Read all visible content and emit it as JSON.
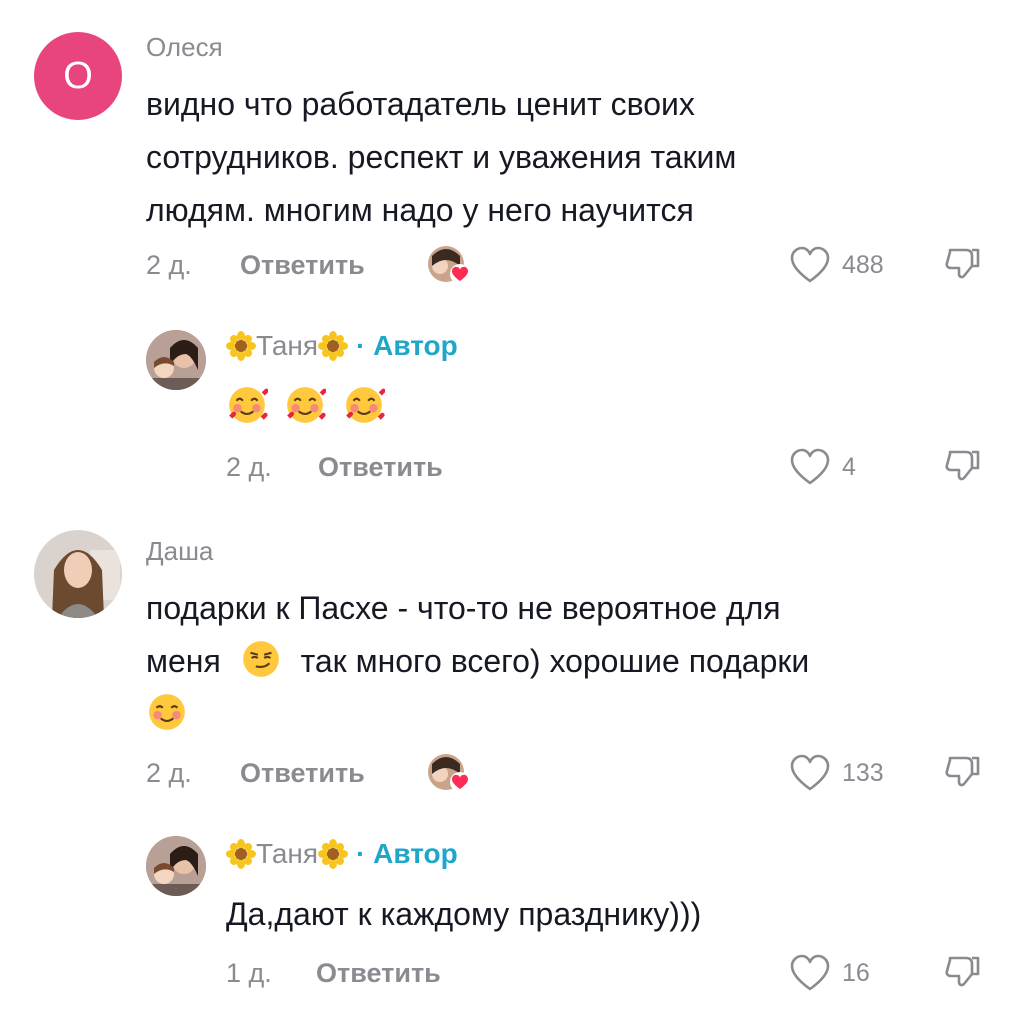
{
  "comments": [
    {
      "username": "Олеся",
      "avatar_letter": "О",
      "text_lines": [
        "видно что работадатель ценит своих",
        "сотрудников. респект и уважения таким",
        "людям. многим надо у него научится"
      ],
      "time": "2 д.",
      "reply_label": "Ответить",
      "likes": "488",
      "author_reply": {
        "name": "Таня",
        "author_label": "· Автор",
        "text": "",
        "time": "2 д.",
        "reply_label": "Ответить",
        "likes": "4"
      }
    },
    {
      "username": "Даша",
      "text_line1": "подарки к Пасхе - что-то не вероятное для",
      "text_line2_a": "меня",
      "text_line2_b": "так много всего) хорошие подарки",
      "time": "2 д.",
      "reply_label": "Ответить",
      "likes": "133",
      "author_reply": {
        "name": "Таня",
        "author_label": "· Автор",
        "text": "Да,дают к каждому празднику)))",
        "time": "1 д.",
        "reply_label": "Ответить",
        "likes": "16"
      }
    }
  ],
  "icons": {
    "like": "heart-outline-icon",
    "dislike": "thumbs-down-icon",
    "liked_by_author": "author-liked-avatar-icon"
  },
  "colors": {
    "avatar_pink": "#e8457f",
    "author_badge": "#20a6c9",
    "muted": "#8a8b91",
    "text": "#161823"
  }
}
